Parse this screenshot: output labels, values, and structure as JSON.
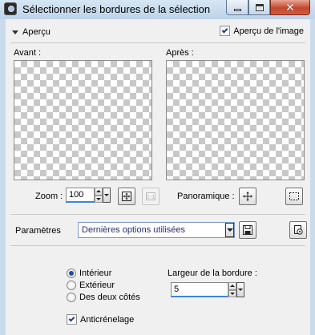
{
  "window": {
    "title": "Sélectionner les bordures de la sélection"
  },
  "preview": {
    "toggle_label": "Aperçu",
    "image_preview_label": "Aperçu de l'image",
    "image_preview_checked": true,
    "before_label": "Avant :",
    "after_label": "Après :"
  },
  "zoom": {
    "label": "Zoom :",
    "value": "100"
  },
  "pan": {
    "label": "Panoramique :"
  },
  "params": {
    "label": "Paramètres",
    "preset": "Dernières options utilisées"
  },
  "position": {
    "options": [
      "Intérieur",
      "Extérieur",
      "Des deux côtés"
    ],
    "selected": "Intérieur"
  },
  "border_width": {
    "label": "Largeur de la bordure :",
    "value": "5"
  },
  "antialias": {
    "label": "Anticrénelage",
    "checked": true
  },
  "icons": {
    "app": "paint-shop-pro-icon",
    "fit": "fit-to-window-icon",
    "actual_size": "actual-size-icon",
    "pan": "pan-move-icon",
    "selection": "selection-marquee-icon",
    "save": "save-floppy-icon",
    "manage": "preset-manage-icon"
  },
  "colors": {
    "title_bar": "#c9dcec",
    "dialog_bg": "#f0f0f0",
    "close_button": "#c3472f",
    "accent": "#1d4e9a"
  }
}
